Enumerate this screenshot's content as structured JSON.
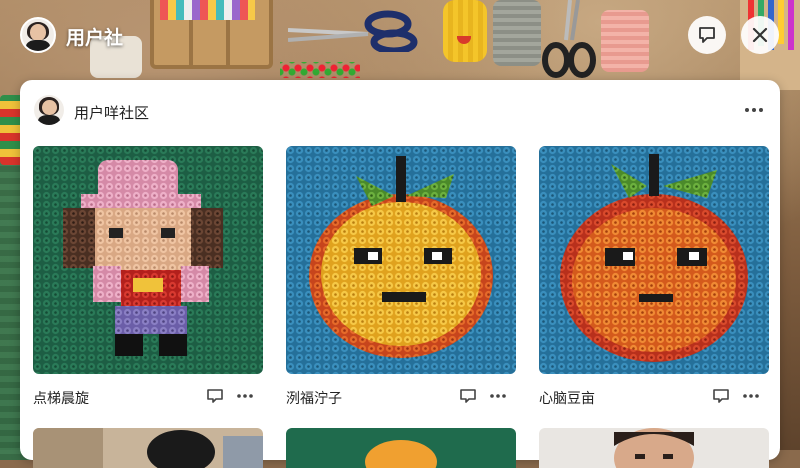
{
  "header": {
    "app_title": "用户社",
    "chat_icon": "chat-icon",
    "close_icon": "close-icon"
  },
  "card": {
    "title": "用户咩社区",
    "more_icon": "more-horizontal-icon"
  },
  "posts": [
    {
      "caption": "点梯晨旋",
      "subject": "pixel girl with pink hat",
      "background": "#1f6b4d"
    },
    {
      "caption": "洌福泞子",
      "subject": "yellow-orange fruit face",
      "background": "#2f7fa8"
    },
    {
      "caption": "心脑豆亩",
      "subject": "orange fruit face",
      "background": "#2f7fa8"
    }
  ],
  "colors": {
    "accent_white": "#ffffff",
    "text_dark": "#222222",
    "icon_grey": "#444444"
  }
}
